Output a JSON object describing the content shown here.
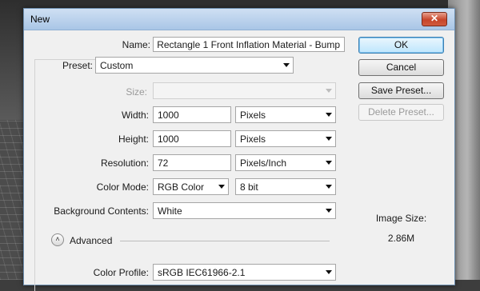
{
  "dialog": {
    "title": "New",
    "close_glyph": "✕"
  },
  "form": {
    "name_label": "Name:",
    "name_value": "Rectangle 1 Front Inflation Material - Bump",
    "preset_label": "Preset:",
    "preset_value": "Custom",
    "size_label": "Size:",
    "size_value": "",
    "width_label": "Width:",
    "width_value": "1000",
    "width_unit": "Pixels",
    "height_label": "Height:",
    "height_value": "1000",
    "height_unit": "Pixels",
    "resolution_label": "Resolution:",
    "resolution_value": "72",
    "resolution_unit": "Pixels/Inch",
    "color_mode_label": "Color Mode:",
    "color_mode_value": "RGB Color",
    "bit_depth_value": "8 bit",
    "background_label": "Background Contents:",
    "background_value": "White",
    "advanced_label": "Advanced",
    "advanced_glyph": "˄",
    "color_profile_label": "Color Profile:",
    "color_profile_value": "sRGB IEC61966-2.1"
  },
  "buttons": {
    "ok": "OK",
    "cancel": "Cancel",
    "save_preset": "Save Preset...",
    "delete_preset": "Delete Preset..."
  },
  "info": {
    "image_size_label": "Image Size:",
    "image_size_value": "2.86M"
  }
}
